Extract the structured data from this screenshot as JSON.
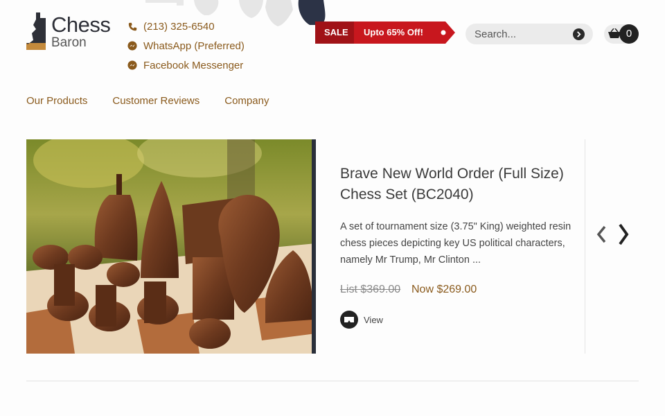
{
  "header": {
    "logo": {
      "line1": "Chess",
      "line2": "Baron"
    },
    "contacts": [
      {
        "icon": "phone-icon",
        "label": "(213) 325-6540"
      },
      {
        "icon": "whatsapp-icon",
        "label": "WhatsApp (Preferred)"
      },
      {
        "icon": "messenger-icon",
        "label": "Facebook Messenger"
      }
    ],
    "promo": {
      "tag": "SALE",
      "text": "Upto 65% Off!"
    },
    "search": {
      "placeholder": "Search..."
    },
    "cart": {
      "count": "0"
    }
  },
  "nav": {
    "items": [
      "Our Products",
      "Customer Reviews",
      "Company"
    ]
  },
  "product": {
    "title": "Brave New World Order (Full Size) Chess Set (BC2040)",
    "description": "A set of tournament size (3.75\" King) weighted resin chess pieces depicting key US political characters, namely Mr Trump, Mr Clinton ...",
    "list_price": "List $369.00",
    "now_price": "Now $269.00",
    "view_label": "View"
  },
  "colors": {
    "accent_brown": "#8a5a1c",
    "sale_red": "#c8171e",
    "dark": "#222222"
  }
}
